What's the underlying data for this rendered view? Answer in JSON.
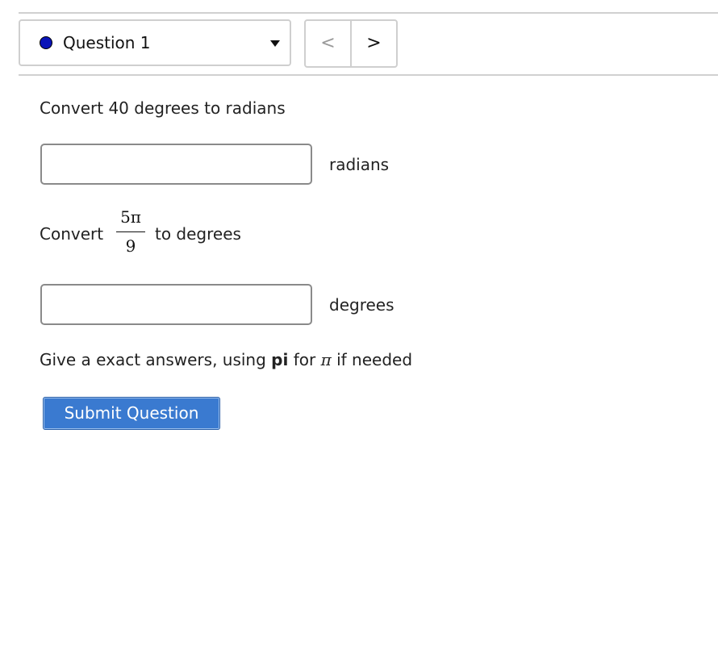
{
  "nav": {
    "question_label": "Question 1",
    "prev_glyph": "<",
    "next_glyph": ">",
    "status_color": "#0a14b8"
  },
  "question": {
    "part1_text": "Convert 40 degrees to radians",
    "part1_unit": "radians",
    "part1_value": "",
    "part2_prefix": "Convert",
    "part2_fraction_numerator": "5π",
    "part2_fraction_denominator": "9",
    "part2_suffix": "to degrees",
    "part2_unit": "degrees",
    "part2_value": "",
    "hint_start": "Give a exact answers, using ",
    "hint_bold": "pi",
    "hint_middle": " for ",
    "hint_symbol": "π",
    "hint_end": " if needed"
  },
  "actions": {
    "submit_label": "Submit Question"
  },
  "colors": {
    "submit_background": "#3a7ad0",
    "divider": "#d0d0d0",
    "text": "#222222"
  }
}
